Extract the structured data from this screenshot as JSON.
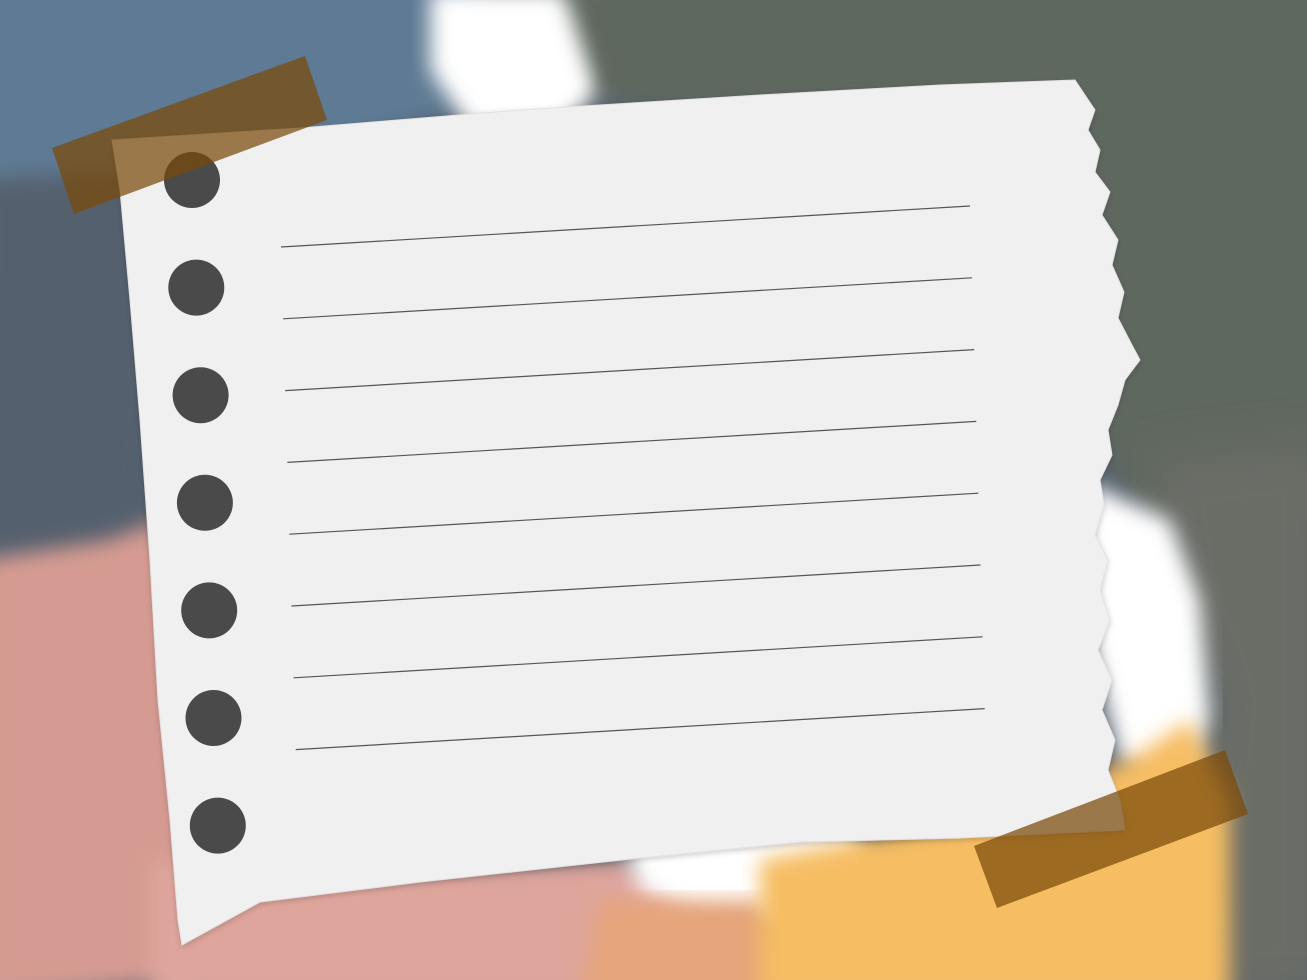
{
  "scene": {
    "description_free": true,
    "colors": {
      "blue_wash": "#5f7a94",
      "slate_wash": "#55616e",
      "olive_wash": "#5f675e",
      "grey_wash": "#6a6d66",
      "pink_wash": "#d59b92",
      "pink_light": "#dea59c",
      "peach_wash": "#e6a57a",
      "yellow_wash": "#f6bd63",
      "white_splash": "#ffffff",
      "paper": "#f0f0f0",
      "paper_edge": "#e2e2e2",
      "rule_line": "#555555",
      "punch_hole": "#4a4a4a",
      "tape": "#7a4a08"
    },
    "paper": {
      "ruled_lines": 8,
      "punch_holes": 7
    },
    "tapes": {
      "count": 2,
      "opacity": 0.72
    }
  }
}
